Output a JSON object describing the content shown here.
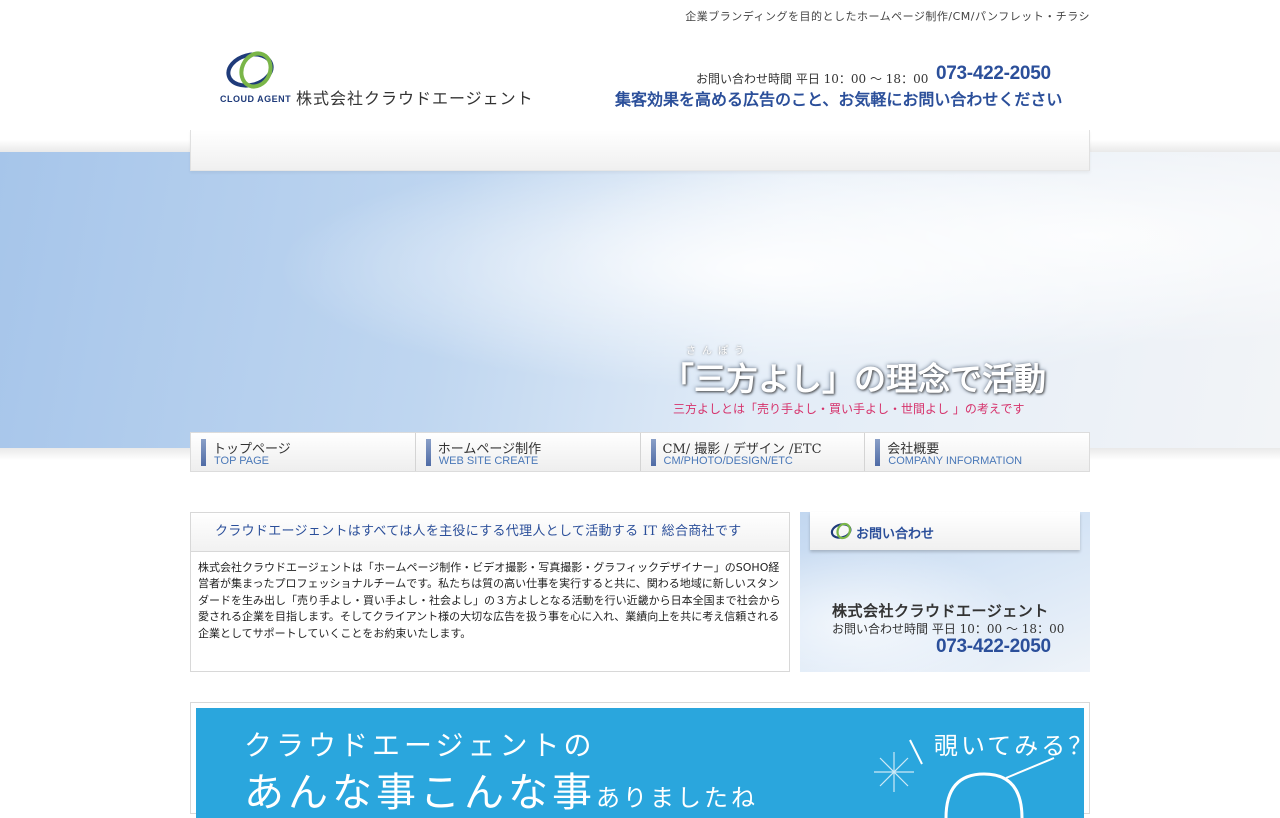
{
  "header": {
    "tagline": "企業ブランディングを目的としたホームページ制作/CM/パンフレット・チラシ",
    "logo_text": "CLOUD AGENT",
    "company_name": "株式会社クラウドエージェント",
    "contact_hours": "お問い合わせ時間 平日 10：00 ～ 18：00",
    "phone": "073-422-2050",
    "pitch": "集客効果を高める広告のこと、お気軽にお問い合わせください"
  },
  "hero": {
    "ruby": "さんぽう",
    "title": "「三方よし」の理念で活動",
    "subtitle": "三方よしとは「売り手よし・買い手よし・世間よし 」の考えです"
  },
  "nav": {
    "items": [
      {
        "jp": "トップページ",
        "en": "TOP PAGE"
      },
      {
        "jp": "ホームページ制作",
        "en": "WEB SITE CREATE"
      },
      {
        "jp": "CM/ 撮影 / デザイン /ETC",
        "en": "CM/PHOTO/DESIGN/ETC"
      },
      {
        "jp": "会社概要",
        "en": "COMPANY INFORMATION"
      }
    ]
  },
  "intro": {
    "heading": "クラウドエージェントはすべては人を主役にする代理人として活動する IT 総合商社です",
    "body": "株式会社クラウドエージェントは「ホームページ制作・ビデオ撮影・写真撮影・グラフィックデザイナー」のSOHO経営者が集まったプロフェッショナルチームです。私たちは質の高い仕事を実行すると共に、関わる地域に新しいスタンダードを生み出し「売り手よし・買い手よし・社会よし」の３方よしとなる活動を行い近畿から日本全国まで社会から愛される企業を目指します。そしてクライアント様の大切な広告を扱う事を心に入れ、業績向上を共に考え信頼される企業としてサポートしていくことをお約束いたします。"
  },
  "contact_box": {
    "heading": "お問い合わせ",
    "company": "株式会社クラウドエージェント",
    "hours": "お問い合わせ時間 平日 10：00 ～ 18：00",
    "phone": "073-422-2050"
  },
  "banner": {
    "line1": "クラウドエージェントの",
    "line2_main": "あんな事こんな事",
    "line2_small": "ありましたね",
    "peek": "覗いてみる？"
  },
  "colors": {
    "brand_blue": "#2b4f9a",
    "logo_green": "#7ab648",
    "accent_pink": "#d6336c",
    "banner_blue": "#2aa6dd"
  }
}
